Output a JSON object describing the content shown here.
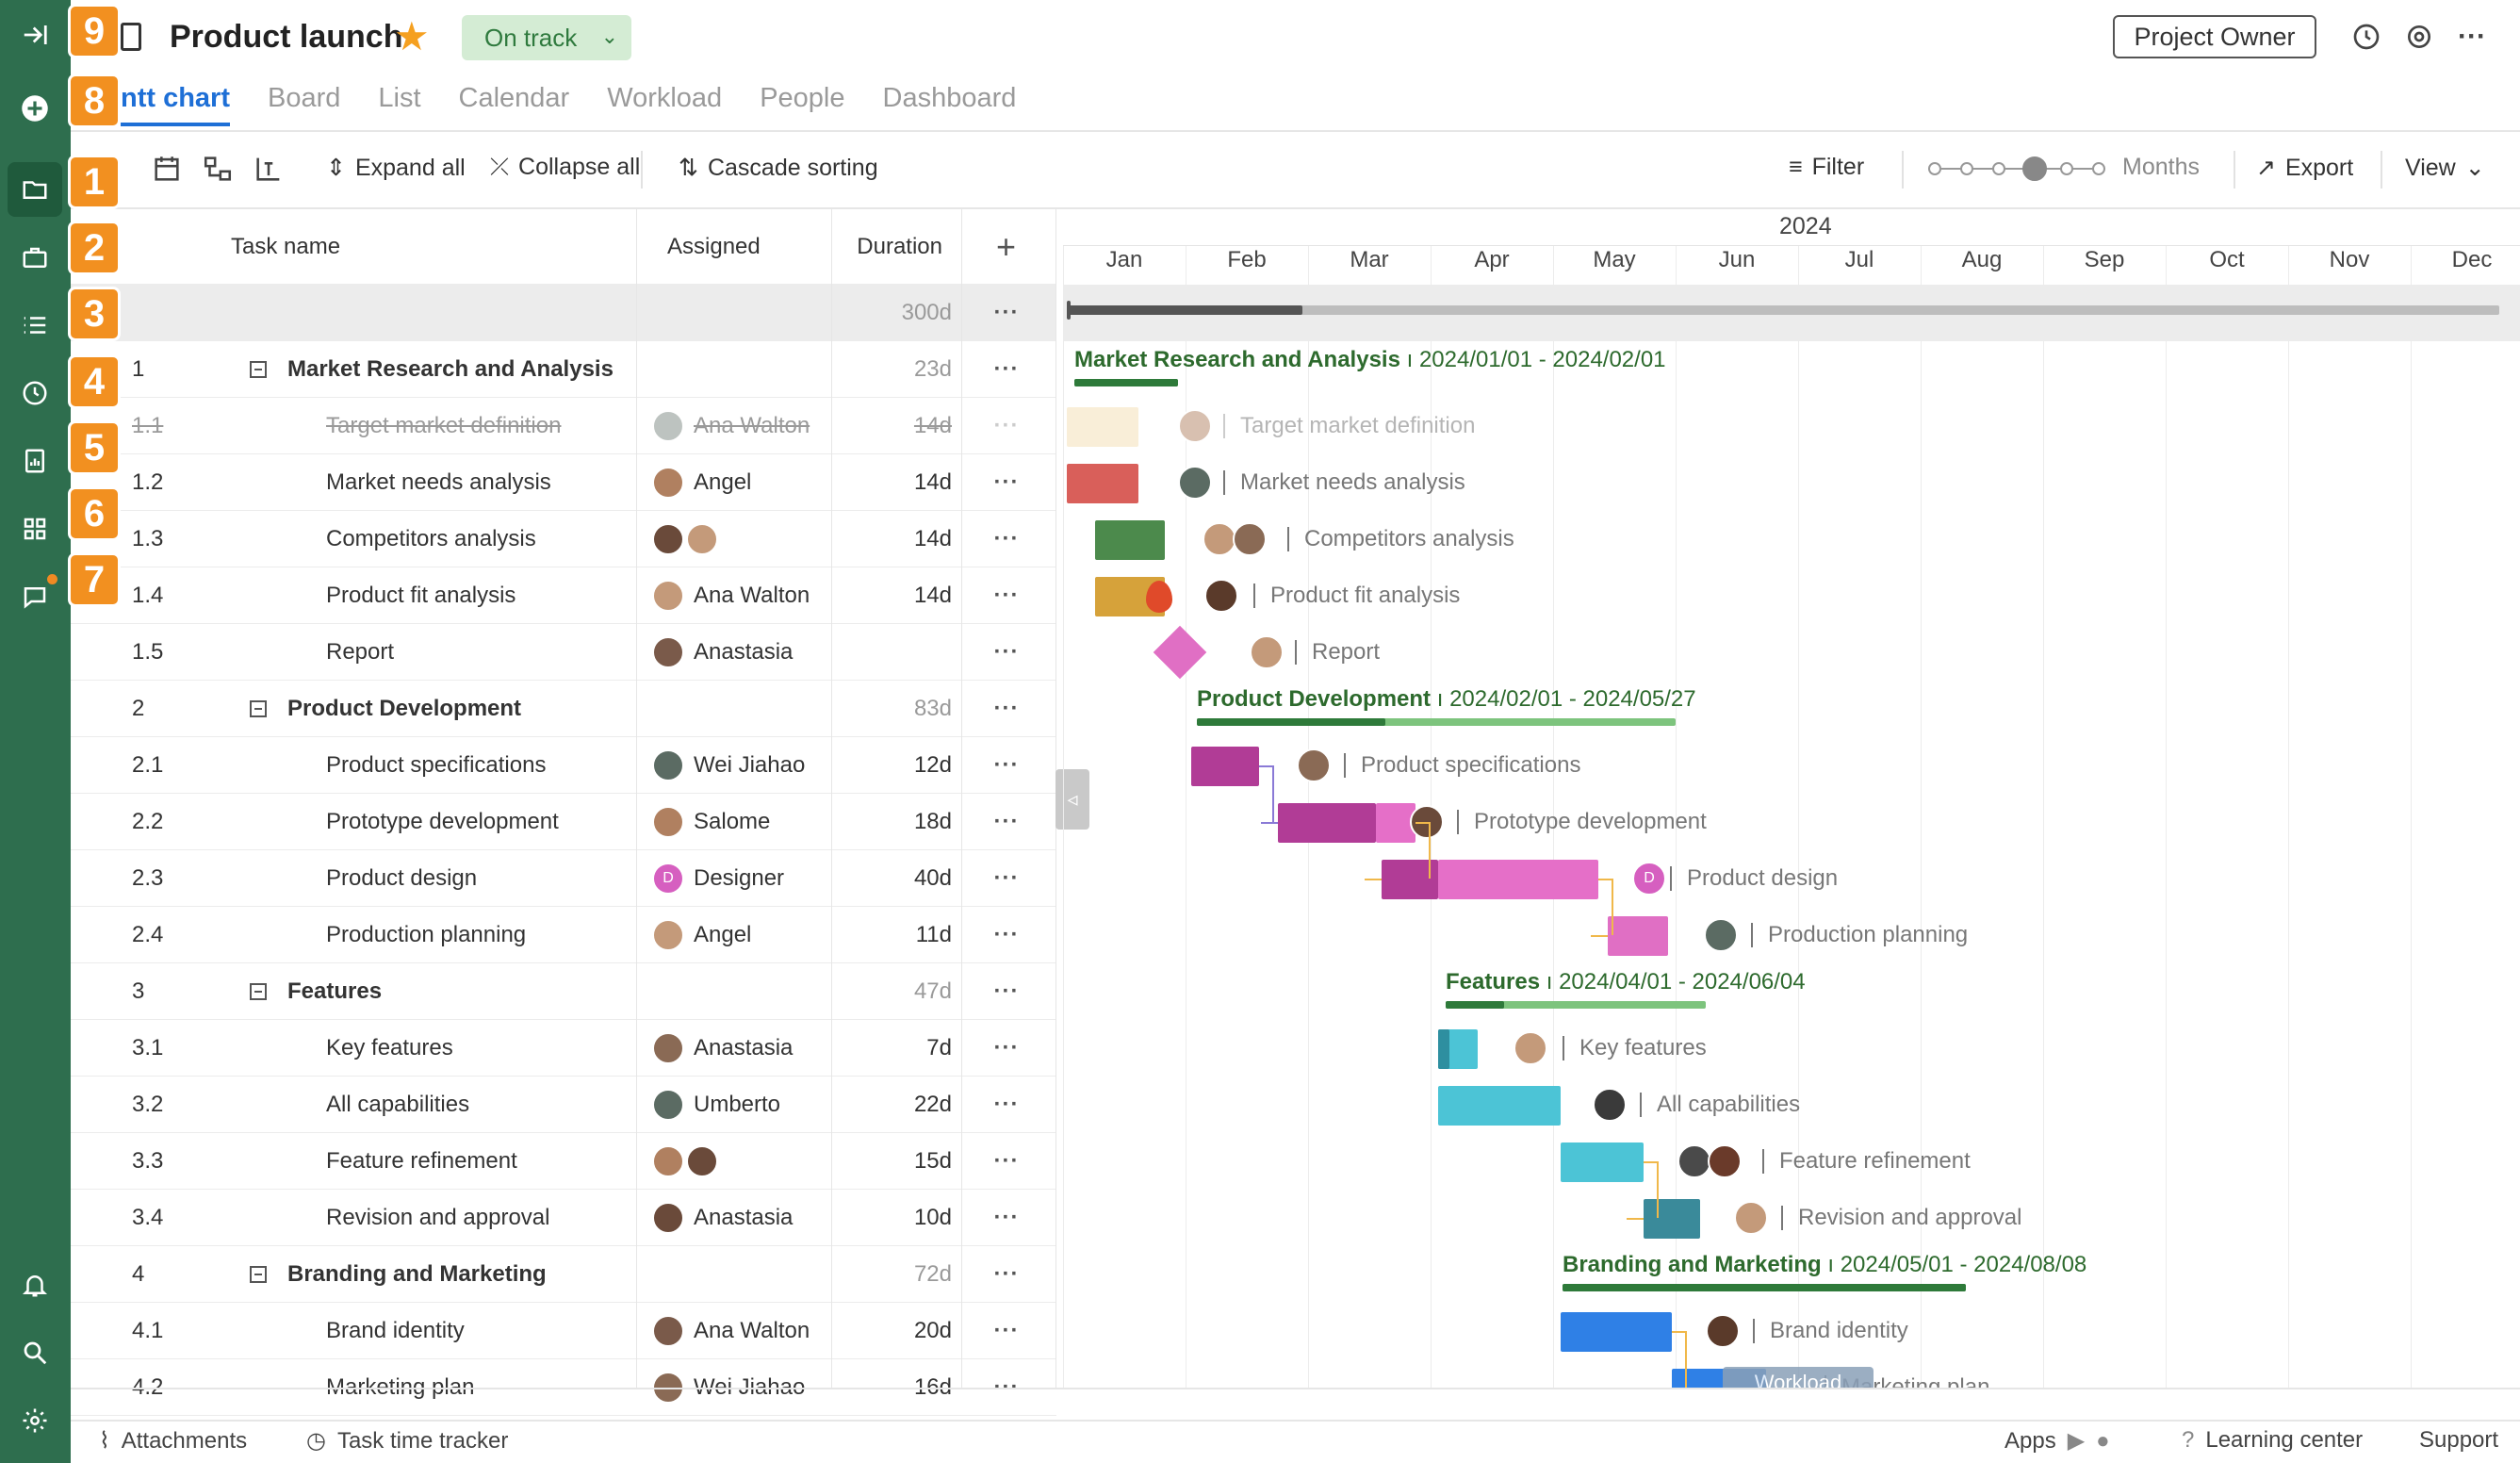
{
  "header": {
    "title": "Product launch",
    "status": "On track",
    "owner_button": "Project Owner"
  },
  "tabs": [
    "Gantt chart",
    "Board",
    "List",
    "Calendar",
    "Workload",
    "People",
    "Dashboard"
  ],
  "tab_visible_first": "ntt chart",
  "badges": [
    "9",
    "8",
    "1",
    "2",
    "3",
    "4",
    "5",
    "6",
    "7"
  ],
  "toolbar": {
    "expand_all": "Expand all",
    "collapse_all": "Collapse all",
    "cascade_sorting": "Cascade sorting",
    "filter": "Filter",
    "zoom_unit": "Months",
    "export": "Export",
    "view": "View"
  },
  "grid": {
    "columns": {
      "task_name": "Task name",
      "assigned": "Assigned",
      "duration": "Duration"
    },
    "project_duration": "300d",
    "rows": [
      {
        "num": "1",
        "name": "Market Research and Analysis",
        "assigned": "",
        "duration": "23d",
        "group": true
      },
      {
        "num": "1.1",
        "name": "Target market definition",
        "assigned": "Ana Walton",
        "duration": "14d",
        "done": true
      },
      {
        "num": "1.2",
        "name": "Market needs analysis",
        "assigned": "Angel",
        "duration": "14d"
      },
      {
        "num": "1.3",
        "name": "Competitors analysis",
        "assigned": "",
        "duration": "14d"
      },
      {
        "num": "1.4",
        "name": "Product fit analysis",
        "assigned": "Ana Walton",
        "duration": "14d"
      },
      {
        "num": "1.5",
        "name": "Report",
        "assigned": "Anastasia",
        "duration": ""
      },
      {
        "num": "2",
        "name": "Product Development",
        "assigned": "",
        "duration": "83d",
        "group": true
      },
      {
        "num": "2.1",
        "name": "Product specifications",
        "assigned": "Wei Jiahao",
        "duration": "12d"
      },
      {
        "num": "2.2",
        "name": "Prototype development",
        "assigned": "Salome",
        "duration": "18d"
      },
      {
        "num": "2.3",
        "name": "Product design",
        "assigned": "Designer",
        "duration": "40d"
      },
      {
        "num": "2.4",
        "name": "Production planning",
        "assigned": "Angel",
        "duration": "11d"
      },
      {
        "num": "3",
        "name": "Features",
        "assigned": "",
        "duration": "47d",
        "group": true
      },
      {
        "num": "3.1",
        "name": "Key features",
        "assigned": "Anastasia",
        "duration": "7d"
      },
      {
        "num": "3.2",
        "name": "All capabilities",
        "assigned": "Umberto",
        "duration": "22d"
      },
      {
        "num": "3.3",
        "name": "Feature refinement",
        "assigned": "",
        "duration": "15d"
      },
      {
        "num": "3.4",
        "name": "Revision and approval",
        "assigned": "Anastasia",
        "duration": "10d"
      },
      {
        "num": "4",
        "name": "Branding and Marketing",
        "assigned": "",
        "duration": "72d",
        "group": true
      },
      {
        "num": "4.1",
        "name": "Brand identity",
        "assigned": "Ana Walton",
        "duration": "20d"
      },
      {
        "num": "4.2",
        "name": "Marketing plan",
        "assigned": "Wei Jiahao",
        "duration": "16d"
      }
    ]
  },
  "gantt": {
    "year": "2024",
    "months": [
      "Jan",
      "Feb",
      "Mar",
      "Apr",
      "May",
      "Jun",
      "Jul",
      "Aug",
      "Sep",
      "Oct",
      "Nov",
      "Dec"
    ],
    "summaries": [
      {
        "name": "Market Research and Analysis",
        "dates": "2024/01/01 - 2024/02/01"
      },
      {
        "name": "Product Development",
        "dates": "2024/02/01 - 2024/05/27"
      },
      {
        "name": "Features",
        "dates": "2024/04/01 - 2024/06/04"
      },
      {
        "name": "Branding and Marketing",
        "dates": "2024/05/01 - 2024/08/08"
      }
    ],
    "task_labels": [
      "Target market definition",
      "Market needs analysis",
      "Competitors analysis",
      "Product fit analysis",
      "Report",
      "Product specifications",
      "Prototype development",
      "Product design",
      "Production planning",
      "Key features",
      "All capabilities",
      "Feature refinement",
      "Revision and approval",
      "Brand identity",
      "Marketing plan"
    ],
    "workload_chip": "Workload",
    "designer_initial": "D"
  },
  "footer": {
    "attachments": "Attachments",
    "time_tracker": "Task time tracker",
    "apps": "Apps",
    "learning": "Learning center",
    "support": "Support"
  },
  "colors": {
    "rail": "#2e6e4e",
    "accent": "#1e6fd6",
    "badge": "#f29020",
    "summary_text": "#2d6a2d"
  }
}
